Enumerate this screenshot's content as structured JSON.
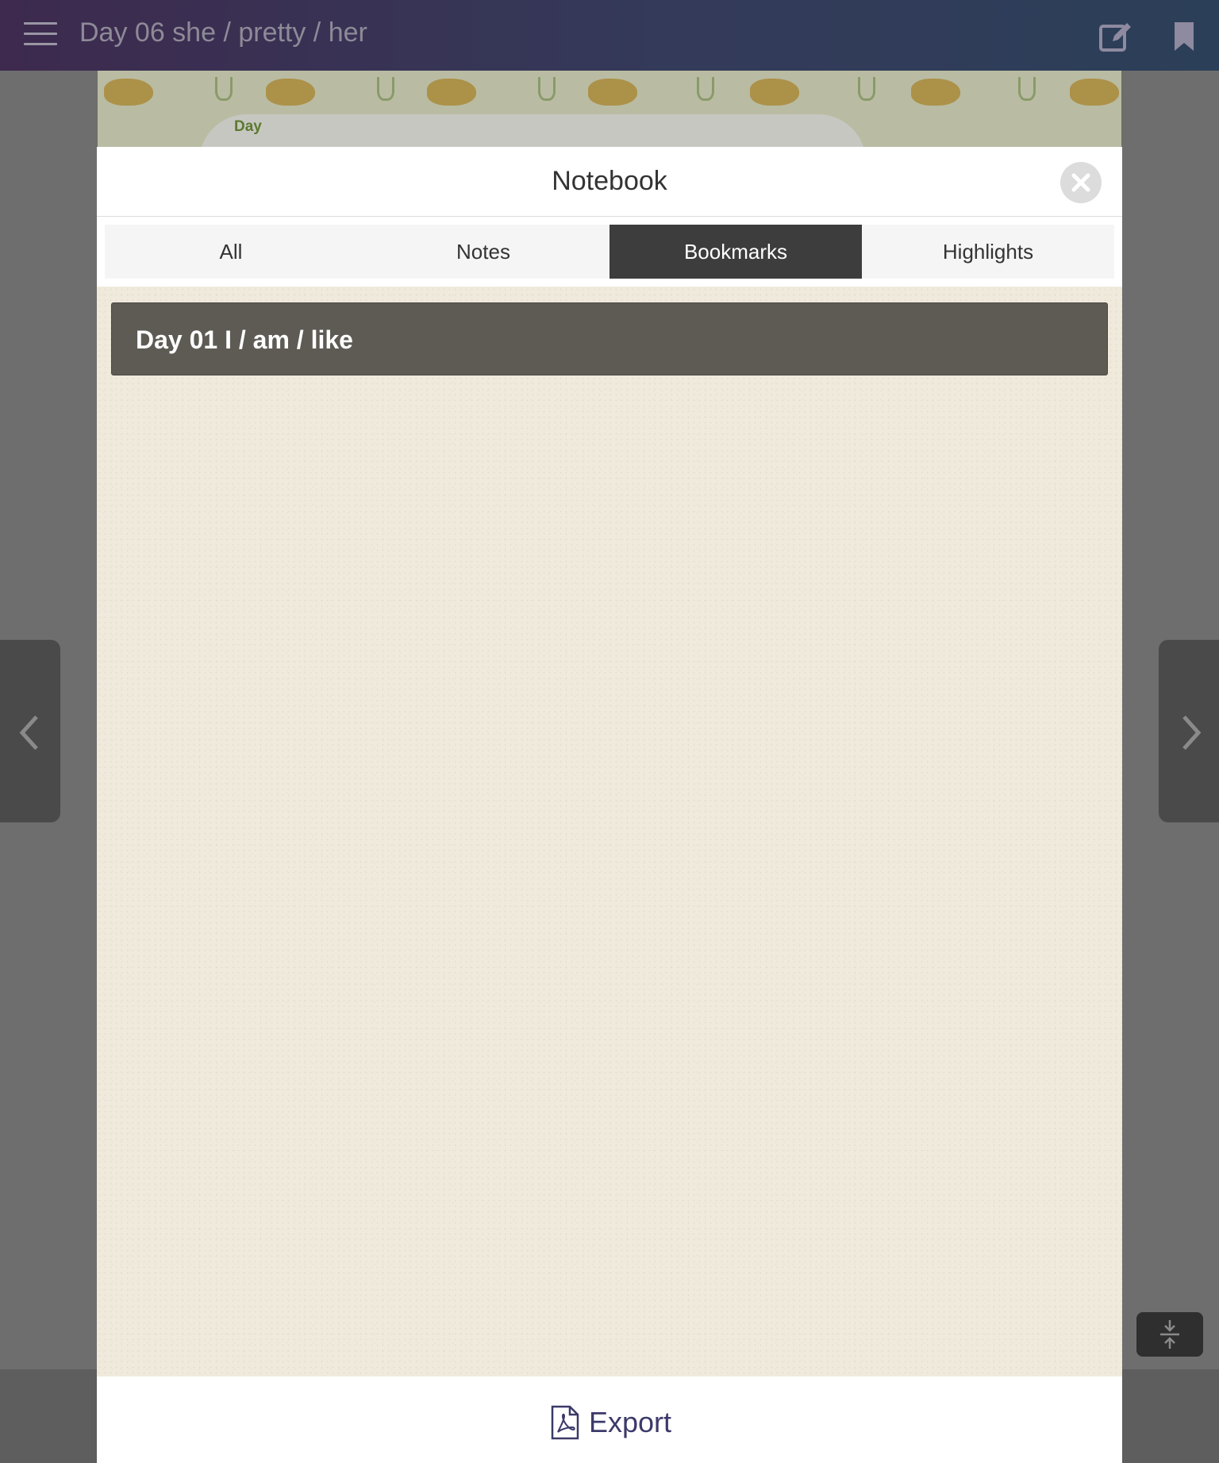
{
  "topbar": {
    "title": "Day 06 she / pretty / her",
    "icons": [
      "hamburger-menu-icon",
      "edit-note-icon",
      "bookmark-icon"
    ]
  },
  "book": {
    "banner_day_label": "Day"
  },
  "dialog": {
    "title": "Notebook",
    "close_icon": "close-icon",
    "tabs": [
      {
        "label": "All",
        "active": false
      },
      {
        "label": "Notes",
        "active": false
      },
      {
        "label": "Bookmarks",
        "active": true
      },
      {
        "label": "Highlights",
        "active": false
      }
    ],
    "items": [
      {
        "label": "Day 01 I / am / like"
      }
    ],
    "export_label": "Export",
    "export_icon": "pdf-file-icon"
  },
  "navigation": {
    "prev_icon": "chevron-left-icon",
    "next_icon": "chevron-right-icon",
    "fit_icon": "collapse-vertical-icon"
  },
  "colors": {
    "topbar_start": "#3d2a4e",
    "topbar_end": "#2b3f58",
    "active_tab": "#3d3d3d",
    "list_item": "#5e5b55",
    "list_background": "#efeadc",
    "export_text": "#3c3a6a"
  }
}
